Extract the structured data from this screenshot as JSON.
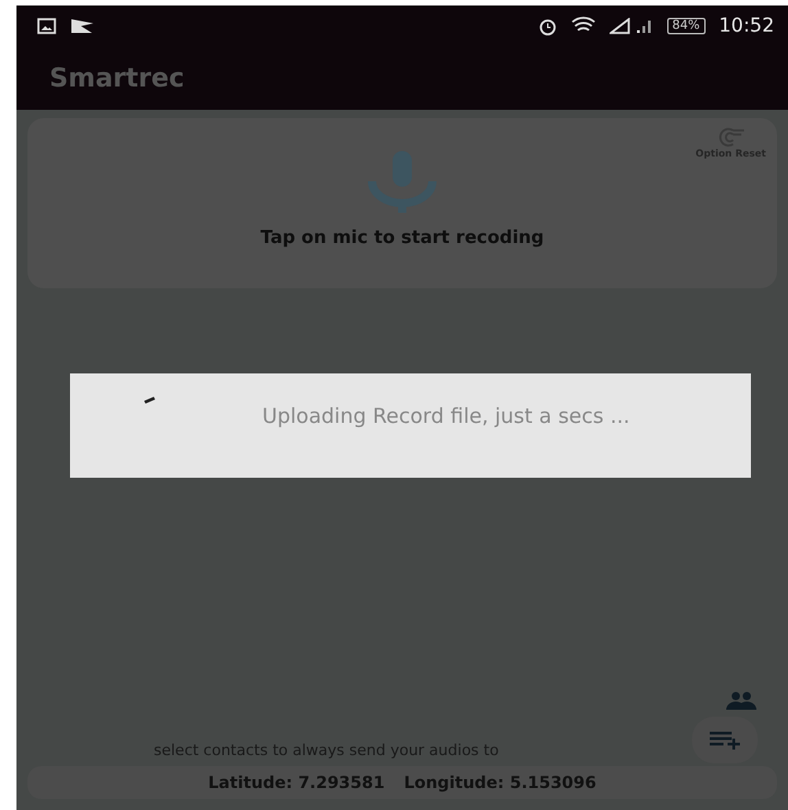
{
  "status_bar": {
    "battery": "84%",
    "time": "10:52"
  },
  "app_bar": {
    "title": "Smartrec"
  },
  "record_card": {
    "option_label": "Option Reset",
    "prompt": "Tap on mic to start recoding"
  },
  "progress_dialog": {
    "message": "Uploading Record file, just a secs ..."
  },
  "contacts_hint": "select contacts to always send your audios to",
  "location": {
    "latitude": "Latitude: 7.293581",
    "longitude": "Longitude: 5.153096"
  }
}
